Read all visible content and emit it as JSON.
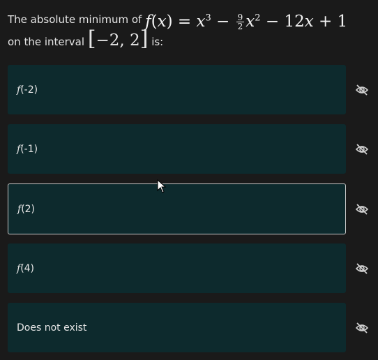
{
  "question": {
    "prefix": "The absolute minimum of",
    "line2_prefix": "on the interval",
    "line2_suffix": "is:",
    "interval": "−2, 2"
  },
  "options": [
    {
      "fn": "f",
      "arg": "(-2)"
    },
    {
      "fn": "f",
      "arg": "(-1)"
    },
    {
      "fn": "f",
      "arg": "(2)"
    },
    {
      "fn": "f",
      "arg": "(4)"
    },
    {
      "text": "Does not exist"
    }
  ],
  "selected_index": 2,
  "icons": {
    "hide": "eye-slash-icon",
    "cursor": "mouse-pointer-icon"
  },
  "colors": {
    "background": "#1a1a1a",
    "option_bg": "#0d2a2d",
    "selected_border": "#c9c9c9"
  }
}
